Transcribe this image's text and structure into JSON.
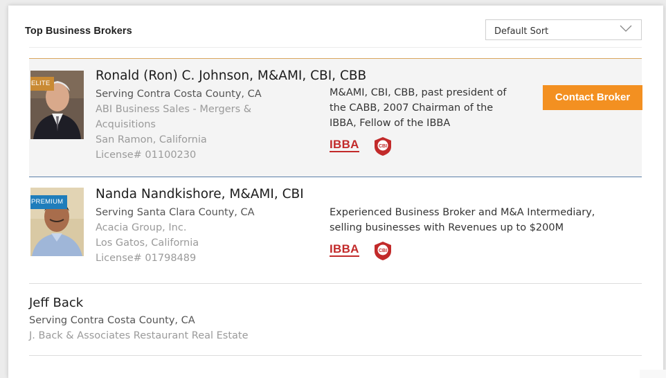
{
  "header": {
    "title": "Top Business Brokers",
    "sort_value": "Default Sort"
  },
  "colors": {
    "elite_badge": "#c98a33",
    "premium_badge": "#1f7dbb",
    "contact_button": "#f39021",
    "logo_red": "#c22a2a"
  },
  "brokers": [
    {
      "tier": "ELITE",
      "name": "Ronald (Ron) C. Johnson, M&AMI, CBI, CBB",
      "serving": "Serving Contra Costa County, CA",
      "company_line1": "ABI Business Sales - Mergers &",
      "company_line2": "Acquisitions",
      "location": "San Ramon, California",
      "license": "License# 01100230",
      "desc_line1": "M&AMI, CBI, CBB, past president of",
      "desc_line2": "the CABB, 2007 Chairman of the",
      "desc_line3": "IBBA, Fellow of the IBBA",
      "contact_label": "Contact Broker",
      "logo_ibba": "IBBA",
      "logo_cbi": "CBI"
    },
    {
      "tier": "PREMIUM",
      "name": "Nanda Nandkishore, M&AMI, CBI",
      "serving": "Serving Santa Clara County, CA",
      "company_line1": "Acacia Group, Inc.",
      "location": "Los Gatos, California",
      "license": "License# 01798489",
      "desc_line1": "Experienced Business Broker and M&A Intermediary,",
      "desc_line2": "selling businesses with Revenues up to $200M",
      "logo_ibba": "IBBA",
      "logo_cbi": "CBI"
    },
    {
      "name": "Jeff Back",
      "serving": "Serving Contra Costa County, CA",
      "company_line1": "J. Back & Associates Restaurant Real Estate"
    }
  ]
}
